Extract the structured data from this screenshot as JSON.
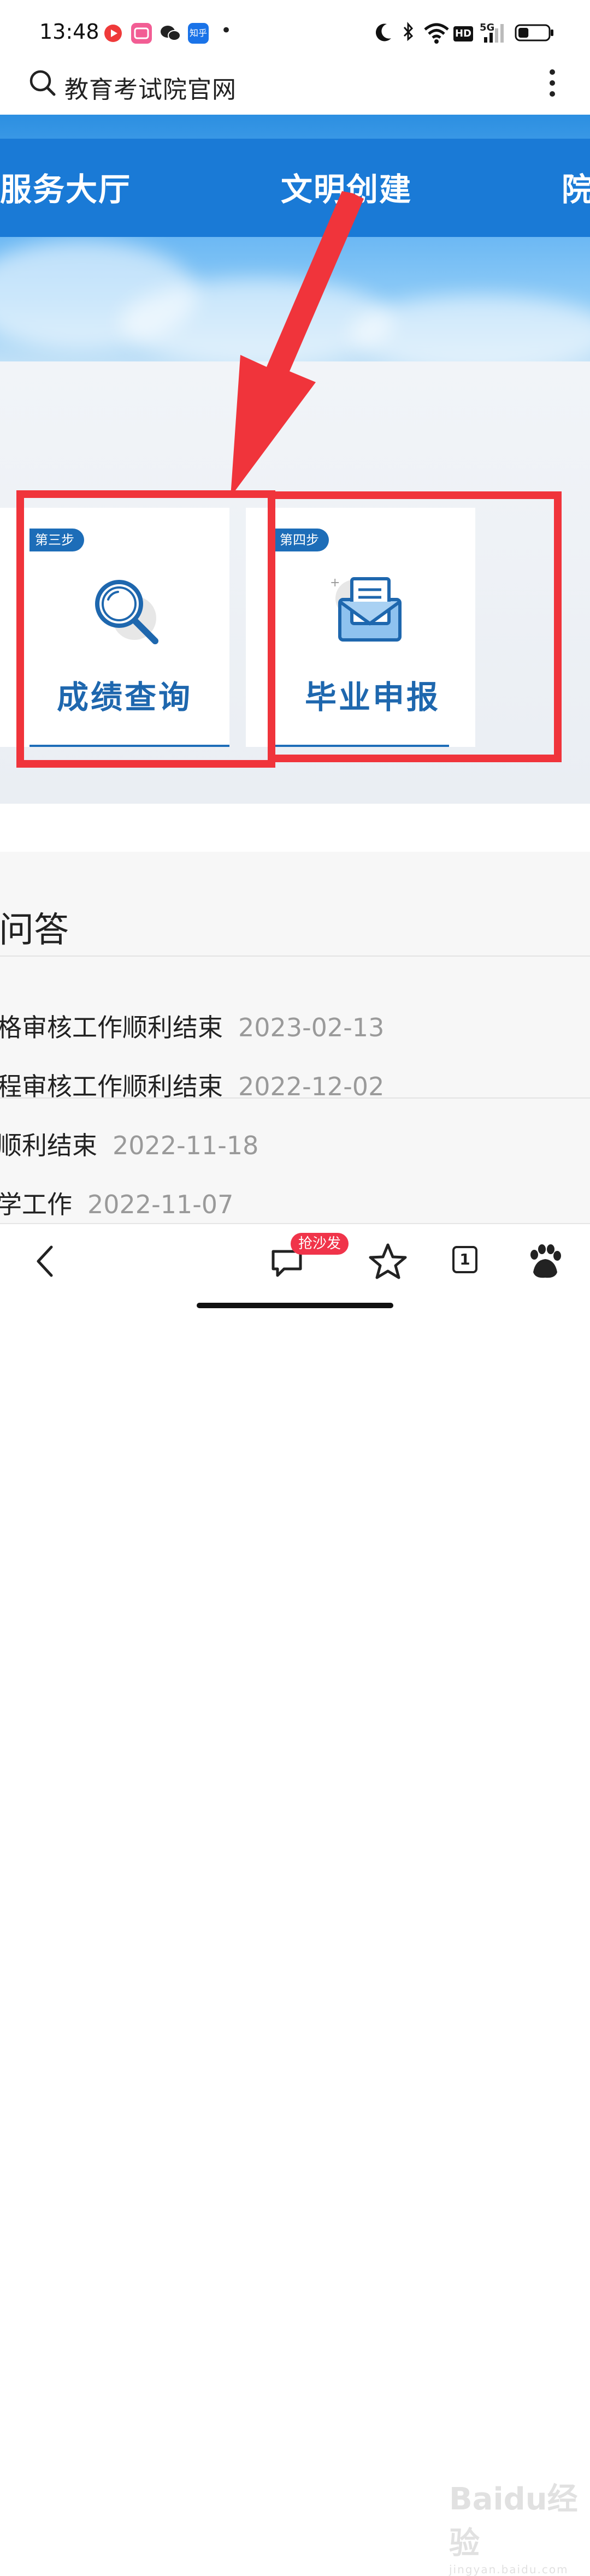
{
  "status_bar": {
    "time": "13:48",
    "apps": [
      {
        "icon": "red-play-app-icon",
        "color": "#ef3a3a"
      },
      {
        "icon": "pink-app-icon",
        "color": "#f25d94"
      },
      {
        "icon": "wechat-icon",
        "color": "#222222"
      },
      {
        "icon": "zhihu-icon",
        "color": "#1a73e8",
        "label": "知乎"
      }
    ],
    "dot": "•",
    "network_badge": "HD",
    "signal_label": "5G",
    "battery": {
      "level": 0.35
    }
  },
  "address_bar": {
    "title": "教育考试院官网"
  },
  "nav": {
    "items": [
      "服务大厅",
      "文明创建",
      "院"
    ]
  },
  "steps": [
    {
      "tag": "第三步",
      "label": "成绩查询",
      "icon": "magnifier-icon"
    },
    {
      "tag": "第四步",
      "label": "毕业申报",
      "icon": "envelope-icon"
    }
  ],
  "faq": {
    "heading": "问答",
    "rows": [
      {
        "text": "格审核工作顺利结束",
        "date": "2023-02-13"
      },
      {
        "text": "程审核工作顺利结束",
        "date": "2022-12-02"
      },
      {
        "text": "顺利结束",
        "date": "2022-11-18"
      },
      {
        "text": "学工作",
        "date": "2022-11-07"
      }
    ]
  },
  "bottom_bar": {
    "comment_badge": "抢沙发",
    "tab_count": "1"
  },
  "watermark": {
    "brand": "Baidu经验",
    "url": "jingyan.baidu.com"
  },
  "colors": {
    "accent_blue": "#1a7ad6",
    "step_blue": "#1e67ae",
    "annotation_red": "#f0343b"
  }
}
